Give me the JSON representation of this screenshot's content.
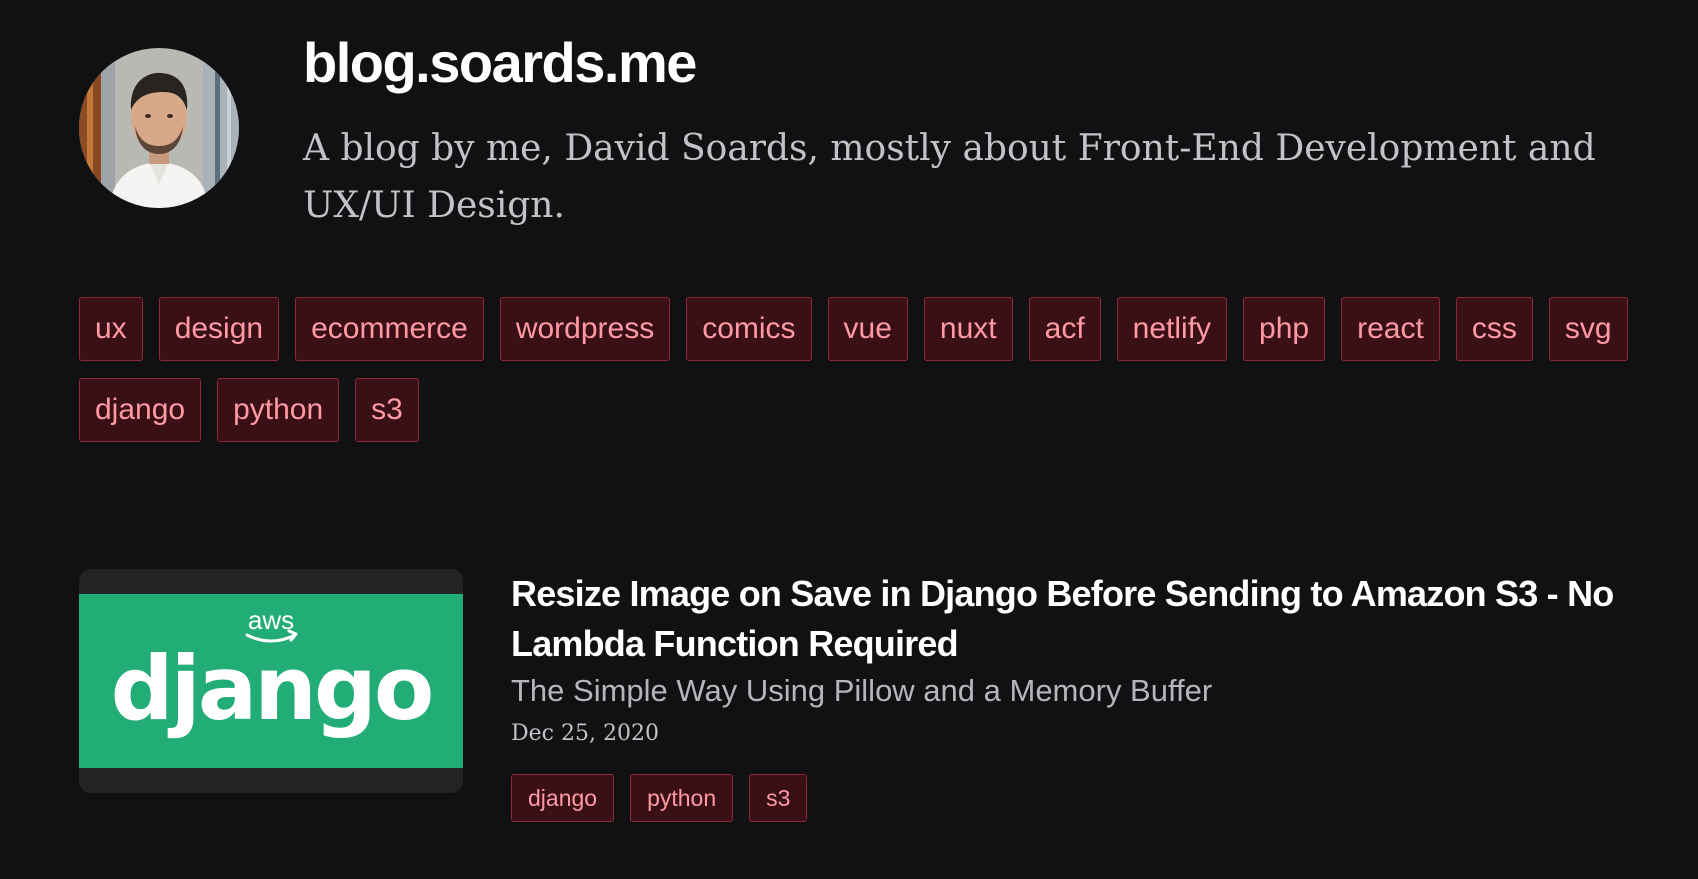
{
  "header": {
    "title": "blog.soards.me",
    "tagline": "A blog by me, David Soards, mostly about Front-End Development and UX/UI Design.",
    "avatar_alt": "David Soards"
  },
  "tags": [
    {
      "label": "ux"
    },
    {
      "label": "design"
    },
    {
      "label": "ecommerce"
    },
    {
      "label": "wordpress"
    },
    {
      "label": "comics"
    },
    {
      "label": "vue"
    },
    {
      "label": "nuxt"
    },
    {
      "label": "acf"
    },
    {
      "label": "netlify"
    },
    {
      "label": "php"
    },
    {
      "label": "react"
    },
    {
      "label": "css"
    },
    {
      "label": "svg"
    },
    {
      "label": "django"
    },
    {
      "label": "python"
    },
    {
      "label": "s3"
    }
  ],
  "posts": [
    {
      "thumbnail": {
        "logo_text": "django",
        "badge_text": "aws",
        "background_color": "#22ad77"
      },
      "title": "Resize Image on Save in Django Before Sending to Amazon S3 - No Lambda Function Required",
      "subtitle": "The Simple Way Using Pillow and a Memory Buffer",
      "date": "Dec 25, 2020",
      "tags": [
        {
          "label": "django"
        },
        {
          "label": "python"
        },
        {
          "label": "s3"
        }
      ]
    }
  ],
  "colors": {
    "background": "#111114",
    "tag_background": "#3a0f16",
    "tag_border": "#8a2b37",
    "tag_text": "#ff9aa4"
  }
}
